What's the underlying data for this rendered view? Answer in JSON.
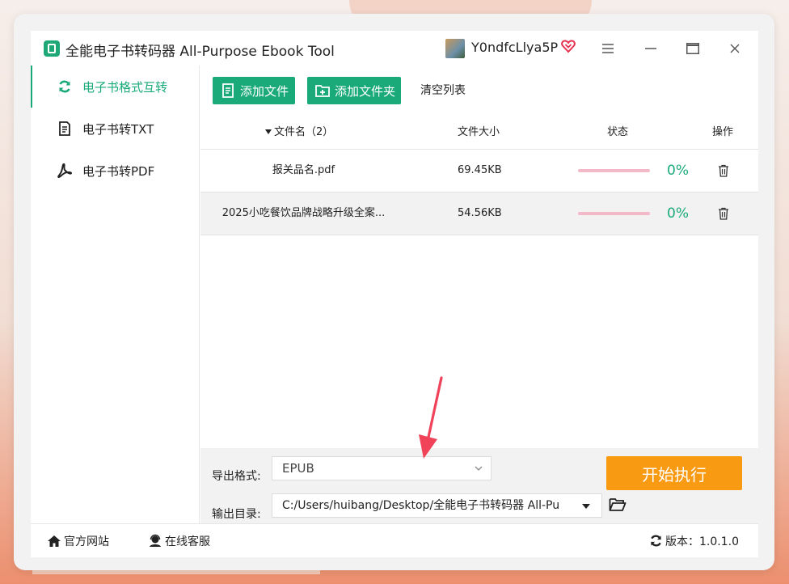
{
  "app": {
    "title": "全能电子书转码器 All-Purpose Ebook Tool",
    "username": "Y0ndfcLlya5P"
  },
  "sidebar": {
    "items": [
      {
        "label": "电子书格式互转",
        "icon": "sync-icon",
        "active": true
      },
      {
        "label": "电子书转TXT",
        "icon": "document-icon",
        "active": false
      },
      {
        "label": "电子书转PDF",
        "icon": "pdf-icon",
        "active": false
      }
    ]
  },
  "toolbar": {
    "add_file": "添加文件",
    "add_folder": "添加文件夹",
    "clear_list": "清空列表"
  },
  "table": {
    "headers": {
      "name": "文件名（2）",
      "size": "文件大小",
      "status": "状态",
      "action": "操作"
    },
    "rows": [
      {
        "name": "报关品名.pdf",
        "size": "69.45KB",
        "progress": "0%",
        "progress_value": 0
      },
      {
        "name": "2025小吃餐饮品牌战略升级全案...",
        "size": "54.56KB",
        "progress": "0%",
        "progress_value": 0
      }
    ]
  },
  "settings": {
    "format_label": "导出格式:",
    "format_value": "EPUB",
    "dir_label": "输出目录:",
    "dir_value": "C:/Users/huibang/Desktop/全能电子书转码器 All-Pu",
    "start_button": "开始执行"
  },
  "footer": {
    "website": "官方网站",
    "service": "在线客服",
    "version": "版本：1.0.1.0"
  },
  "colors": {
    "accent": "#1aaa79",
    "start": "#f99a13",
    "progress_track": "#f4b9c8",
    "annotation": "#f0435a"
  }
}
